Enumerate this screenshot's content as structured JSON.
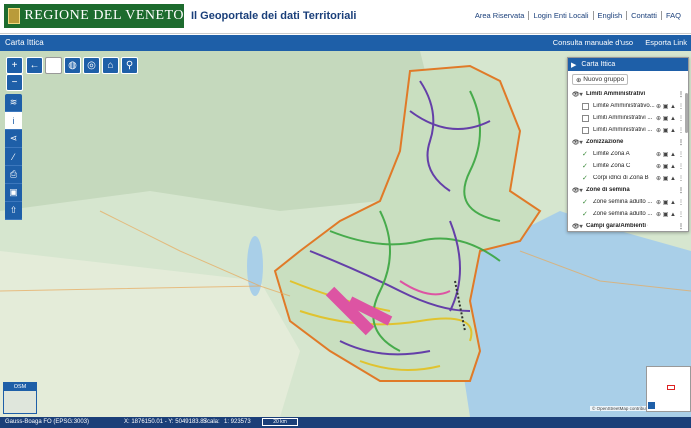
{
  "header": {
    "logo_text": "REGIONE DEL VENETO",
    "title": "Il Geoportale dei dati Territoriali",
    "links": [
      "Area Riservata",
      "Login Enti Locali",
      "English",
      "Contatti",
      "FAQ"
    ]
  },
  "titlebar": {
    "app_title": "Carta Ittica",
    "manual_link": "Consulta manuale d'uso",
    "export_link": "Esporta Link"
  },
  "toolbar": {
    "zoom_in": "+",
    "zoom_out": "−",
    "icons": [
      "back-arrow-icon",
      "blank-icon",
      "globe-icon",
      "locate-icon",
      "home-icon",
      "search-icon"
    ]
  },
  "side_tools": [
    "layers-icon",
    "info-icon",
    "share-icon",
    "measure-icon",
    "print-icon",
    "save-icon",
    "export-icon"
  ],
  "layer_panel": {
    "title": "Carta Ittica",
    "new_group": "Nuovo gruppo",
    "rows": [
      {
        "type": "group",
        "label": "Limiti Amministrativi"
      },
      {
        "type": "layer",
        "label": "Limite Amministrativo...",
        "checked": false
      },
      {
        "type": "layer",
        "label": "Limiti Amministrativi ...",
        "checked": false
      },
      {
        "type": "layer",
        "label": "Limiti Amministrativi ...",
        "checked": false
      },
      {
        "type": "group",
        "label": "Zonizzazione"
      },
      {
        "type": "layer",
        "label": "Limite Zona A",
        "checked": true
      },
      {
        "type": "layer",
        "label": "Limite Zona C",
        "checked": true
      },
      {
        "type": "layer",
        "label": "Corpi idrici di Zona B",
        "checked": true
      },
      {
        "type": "group",
        "label": "Zone di semina"
      },
      {
        "type": "layer",
        "label": "Zone semina adulto ...",
        "checked": true
      },
      {
        "type": "layer",
        "label": "Zone semina adulto ...",
        "checked": true
      },
      {
        "type": "group",
        "label": "Campi gara/Ambienti comp..."
      }
    ]
  },
  "basemap": {
    "label": "OSM"
  },
  "attribution": "© OpenStreetMap contributors",
  "footer": {
    "crs": "Gauss-Boaga FO (EPSG:3003)",
    "coords": "X: 1876150.01 - Y: 5049183.87",
    "scale_label": "Scala:",
    "scale_value": "1: 923573",
    "scale_bar": "20 km"
  },
  "colors": {
    "brand_green": "#1d6b2e",
    "primary_blue": "#1e5fa8",
    "footer_blue": "#1b3f78"
  }
}
